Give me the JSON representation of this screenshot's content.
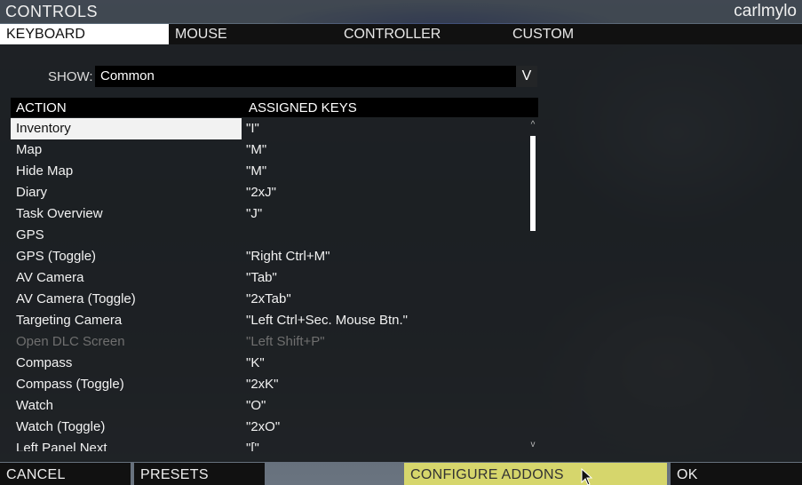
{
  "window": {
    "title": "CONTROLS",
    "user": "carlmylo"
  },
  "tabs": [
    {
      "label": "KEYBOARD"
    },
    {
      "label": "MOUSE"
    },
    {
      "label": "CONTROLLER"
    },
    {
      "label": "CUSTOM"
    }
  ],
  "show": {
    "label": "SHOW:",
    "value": "Common",
    "dropdown_glyph": "V"
  },
  "table": {
    "headers": {
      "action": "ACTION",
      "keys": "ASSIGNED KEYS"
    },
    "rows": [
      {
        "action": "Inventory",
        "keys": "\"I\""
      },
      {
        "action": "Map",
        "keys": "\"M\""
      },
      {
        "action": "Hide Map",
        "keys": "\"M\""
      },
      {
        "action": "Diary",
        "keys": "\"2xJ\""
      },
      {
        "action": "Task Overview",
        "keys": "\"J\""
      },
      {
        "action": "GPS",
        "keys": ""
      },
      {
        "action": "GPS (Toggle)",
        "keys": "\"Right Ctrl+M\""
      },
      {
        "action": "AV Camera",
        "keys": "\"Tab\""
      },
      {
        "action": "AV Camera (Toggle)",
        "keys": "\"2xTab\""
      },
      {
        "action": "Targeting Camera",
        "keys": "\"Left Ctrl+Sec. Mouse Btn.\""
      },
      {
        "action": "Open DLC Screen",
        "keys": "\"Left Shift+P\""
      },
      {
        "action": "Compass",
        "keys": "\"K\""
      },
      {
        "action": "Compass (Toggle)",
        "keys": "\"2xK\""
      },
      {
        "action": "Watch",
        "keys": "\"O\""
      },
      {
        "action": "Watch (Toggle)",
        "keys": "\"2xO\""
      },
      {
        "action": "Left Panel Next",
        "keys": "\"[\""
      }
    ],
    "scroll": {
      "up": "^",
      "down": "v"
    }
  },
  "bottom": {
    "cancel": "CANCEL",
    "presets": "PRESETS",
    "configure_addons": "CONFIGURE ADDONS",
    "ok": "OK"
  },
  "colors": {
    "highlight": "#d6d66c",
    "selected_row": "#f2f2f2",
    "disabled_text": "#6f6f6f"
  }
}
